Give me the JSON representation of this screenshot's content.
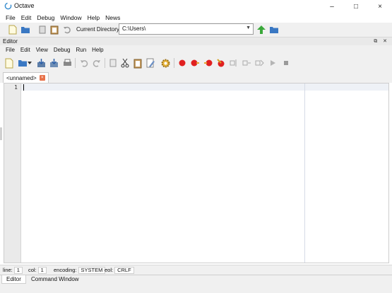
{
  "window": {
    "title": "Octave",
    "minimize": "–",
    "maximize": "□",
    "close": "×"
  },
  "menubar": [
    "File",
    "Edit",
    "Debug",
    "Window",
    "Help",
    "News"
  ],
  "main_toolbar": {
    "current_directory_label": "Current Directory:",
    "current_directory_value": "C:\\Users\\",
    "icons": [
      "new-file-icon",
      "open-folder-icon",
      "copy-icon",
      "paste-icon",
      "undo-icon",
      "up-arrow-icon",
      "browse-folder-icon"
    ]
  },
  "editor": {
    "panel_title": "Editor",
    "dock_buttons": "⧉ ✕",
    "menubar": [
      "File",
      "Edit",
      "View",
      "Debug",
      "Run",
      "Help"
    ],
    "toolbar_icons": [
      "new-script-icon",
      "open-icon",
      "save-icon",
      "save-as-icon",
      "print-icon",
      "undo-icon",
      "redo-icon",
      "copy-icon",
      "cut-icon",
      "paste-icon",
      "find-icon",
      "preferences-icon",
      "toggle-breakpoint-icon",
      "next-breakpoint-icon",
      "previous-breakpoint-icon",
      "remove-breakpoints-icon",
      "step-icon",
      "step-in-icon",
      "step-out-icon",
      "run-icon",
      "stop-icon"
    ],
    "tab": {
      "label": "<unnamed>",
      "close": "×"
    },
    "line_numbers": [
      "1"
    ]
  },
  "statusbar": {
    "line_label": "line:",
    "line_value": "1",
    "col_label": "col:",
    "col_value": "1",
    "encoding_label": "encoding:",
    "encoding_value": "SYSTEM",
    "eol_label": "eol:",
    "eol_value": "CRLF"
  },
  "bottom_tabs": [
    "Editor",
    "Command Window"
  ],
  "colors": {
    "accent_red": "#e02020",
    "folder_blue": "#3a78c3",
    "arrow_green": "#3aa83a"
  }
}
